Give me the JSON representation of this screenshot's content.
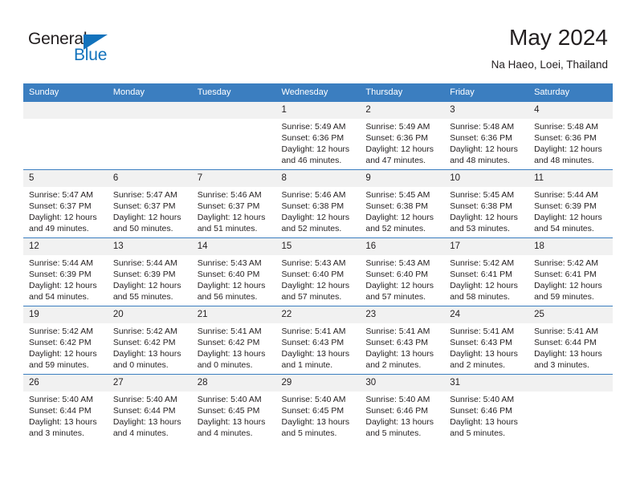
{
  "brand": {
    "name_part1": "General",
    "name_part2": "Blue",
    "logo_icon": "triangle-logo-icon"
  },
  "header": {
    "title": "May 2024",
    "location": "Na Haeo, Loei, Thailand"
  },
  "calendar": {
    "weekday_headers": [
      "Sunday",
      "Monday",
      "Tuesday",
      "Wednesday",
      "Thursday",
      "Friday",
      "Saturday"
    ],
    "accent_color": "#3b7ec0",
    "daynum_bg": "#f1f1f1",
    "weeks": [
      [
        {
          "day": "",
          "blank": true
        },
        {
          "day": "",
          "blank": true
        },
        {
          "day": "",
          "blank": true
        },
        {
          "day": "1",
          "sunrise": "Sunrise: 5:49 AM",
          "sunset": "Sunset: 6:36 PM",
          "daylight": "Daylight: 12 hours and 46 minutes."
        },
        {
          "day": "2",
          "sunrise": "Sunrise: 5:49 AM",
          "sunset": "Sunset: 6:36 PM",
          "daylight": "Daylight: 12 hours and 47 minutes."
        },
        {
          "day": "3",
          "sunrise": "Sunrise: 5:48 AM",
          "sunset": "Sunset: 6:36 PM",
          "daylight": "Daylight: 12 hours and 48 minutes."
        },
        {
          "day": "4",
          "sunrise": "Sunrise: 5:48 AM",
          "sunset": "Sunset: 6:36 PM",
          "daylight": "Daylight: 12 hours and 48 minutes."
        }
      ],
      [
        {
          "day": "5",
          "sunrise": "Sunrise: 5:47 AM",
          "sunset": "Sunset: 6:37 PM",
          "daylight": "Daylight: 12 hours and 49 minutes."
        },
        {
          "day": "6",
          "sunrise": "Sunrise: 5:47 AM",
          "sunset": "Sunset: 6:37 PM",
          "daylight": "Daylight: 12 hours and 50 minutes."
        },
        {
          "day": "7",
          "sunrise": "Sunrise: 5:46 AM",
          "sunset": "Sunset: 6:37 PM",
          "daylight": "Daylight: 12 hours and 51 minutes."
        },
        {
          "day": "8",
          "sunrise": "Sunrise: 5:46 AM",
          "sunset": "Sunset: 6:38 PM",
          "daylight": "Daylight: 12 hours and 52 minutes."
        },
        {
          "day": "9",
          "sunrise": "Sunrise: 5:45 AM",
          "sunset": "Sunset: 6:38 PM",
          "daylight": "Daylight: 12 hours and 52 minutes."
        },
        {
          "day": "10",
          "sunrise": "Sunrise: 5:45 AM",
          "sunset": "Sunset: 6:38 PM",
          "daylight": "Daylight: 12 hours and 53 minutes."
        },
        {
          "day": "11",
          "sunrise": "Sunrise: 5:44 AM",
          "sunset": "Sunset: 6:39 PM",
          "daylight": "Daylight: 12 hours and 54 minutes."
        }
      ],
      [
        {
          "day": "12",
          "sunrise": "Sunrise: 5:44 AM",
          "sunset": "Sunset: 6:39 PM",
          "daylight": "Daylight: 12 hours and 54 minutes."
        },
        {
          "day": "13",
          "sunrise": "Sunrise: 5:44 AM",
          "sunset": "Sunset: 6:39 PM",
          "daylight": "Daylight: 12 hours and 55 minutes."
        },
        {
          "day": "14",
          "sunrise": "Sunrise: 5:43 AM",
          "sunset": "Sunset: 6:40 PM",
          "daylight": "Daylight: 12 hours and 56 minutes."
        },
        {
          "day": "15",
          "sunrise": "Sunrise: 5:43 AM",
          "sunset": "Sunset: 6:40 PM",
          "daylight": "Daylight: 12 hours and 57 minutes."
        },
        {
          "day": "16",
          "sunrise": "Sunrise: 5:43 AM",
          "sunset": "Sunset: 6:40 PM",
          "daylight": "Daylight: 12 hours and 57 minutes."
        },
        {
          "day": "17",
          "sunrise": "Sunrise: 5:42 AM",
          "sunset": "Sunset: 6:41 PM",
          "daylight": "Daylight: 12 hours and 58 minutes."
        },
        {
          "day": "18",
          "sunrise": "Sunrise: 5:42 AM",
          "sunset": "Sunset: 6:41 PM",
          "daylight": "Daylight: 12 hours and 59 minutes."
        }
      ],
      [
        {
          "day": "19",
          "sunrise": "Sunrise: 5:42 AM",
          "sunset": "Sunset: 6:42 PM",
          "daylight": "Daylight: 12 hours and 59 minutes."
        },
        {
          "day": "20",
          "sunrise": "Sunrise: 5:42 AM",
          "sunset": "Sunset: 6:42 PM",
          "daylight": "Daylight: 13 hours and 0 minutes."
        },
        {
          "day": "21",
          "sunrise": "Sunrise: 5:41 AM",
          "sunset": "Sunset: 6:42 PM",
          "daylight": "Daylight: 13 hours and 0 minutes."
        },
        {
          "day": "22",
          "sunrise": "Sunrise: 5:41 AM",
          "sunset": "Sunset: 6:43 PM",
          "daylight": "Daylight: 13 hours and 1 minute."
        },
        {
          "day": "23",
          "sunrise": "Sunrise: 5:41 AM",
          "sunset": "Sunset: 6:43 PM",
          "daylight": "Daylight: 13 hours and 2 minutes."
        },
        {
          "day": "24",
          "sunrise": "Sunrise: 5:41 AM",
          "sunset": "Sunset: 6:43 PM",
          "daylight": "Daylight: 13 hours and 2 minutes."
        },
        {
          "day": "25",
          "sunrise": "Sunrise: 5:41 AM",
          "sunset": "Sunset: 6:44 PM",
          "daylight": "Daylight: 13 hours and 3 minutes."
        }
      ],
      [
        {
          "day": "26",
          "sunrise": "Sunrise: 5:40 AM",
          "sunset": "Sunset: 6:44 PM",
          "daylight": "Daylight: 13 hours and 3 minutes."
        },
        {
          "day": "27",
          "sunrise": "Sunrise: 5:40 AM",
          "sunset": "Sunset: 6:44 PM",
          "daylight": "Daylight: 13 hours and 4 minutes."
        },
        {
          "day": "28",
          "sunrise": "Sunrise: 5:40 AM",
          "sunset": "Sunset: 6:45 PM",
          "daylight": "Daylight: 13 hours and 4 minutes."
        },
        {
          "day": "29",
          "sunrise": "Sunrise: 5:40 AM",
          "sunset": "Sunset: 6:45 PM",
          "daylight": "Daylight: 13 hours and 5 minutes."
        },
        {
          "day": "30",
          "sunrise": "Sunrise: 5:40 AM",
          "sunset": "Sunset: 6:46 PM",
          "daylight": "Daylight: 13 hours and 5 minutes."
        },
        {
          "day": "31",
          "sunrise": "Sunrise: 5:40 AM",
          "sunset": "Sunset: 6:46 PM",
          "daylight": "Daylight: 13 hours and 5 minutes."
        },
        {
          "day": "",
          "blank": true
        }
      ]
    ]
  }
}
